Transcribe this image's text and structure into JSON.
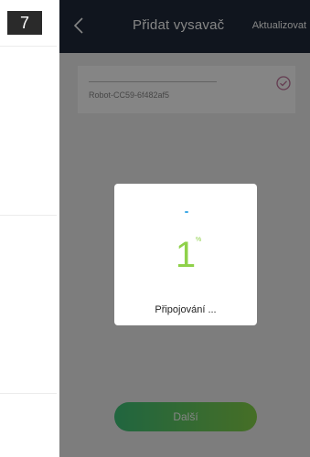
{
  "step": "7",
  "header": {
    "title": "Přidat vysavač",
    "update_label": "Aktualizovat"
  },
  "device": {
    "name": "Robot-CC59-6f482af5"
  },
  "dialog": {
    "progress": "1",
    "unit": "%",
    "status": "Připojování ..."
  },
  "footer": {
    "next_label": "Další"
  },
  "colors": {
    "topbar": "#1f2a3a",
    "accent_green": "#8fd14a",
    "spinner_blue": "#3fa9e6"
  },
  "icons": {
    "back": "chevron-left-icon",
    "check": "check-circle-icon"
  }
}
